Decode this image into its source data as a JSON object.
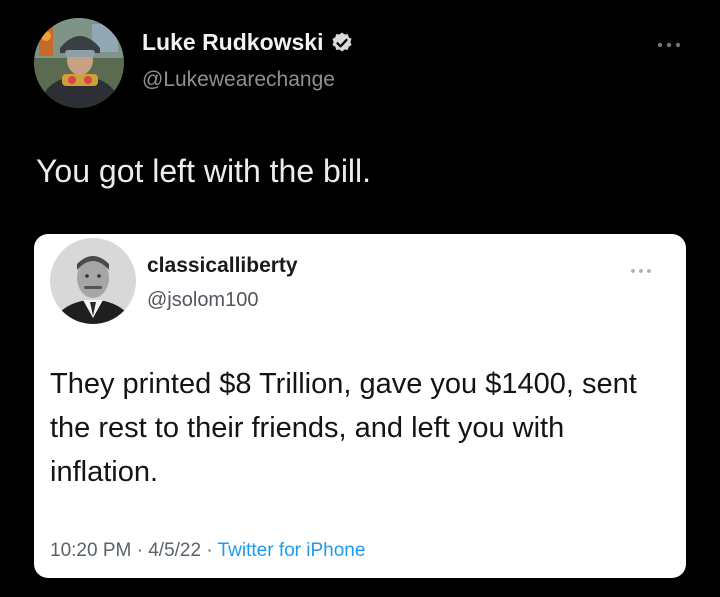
{
  "outer_tweet": {
    "author_name": "Luke Rudkowski",
    "handle": "@Lukewearechange",
    "verified": true,
    "text": "You got left with the bill.",
    "icons": {
      "avatar": "avatar-icon",
      "verified": "verified-badge-icon",
      "more": "more-options-icon"
    }
  },
  "quoted_tweet": {
    "author_name": "classicalliberty",
    "handle": "@jsolom100",
    "text": "They printed $8 Trillion, gave you $1400, sent the rest to their friends, and left you with inflation.",
    "time": "10:20 PM",
    "separator": "·",
    "date": "4/5/22",
    "source": "Twitter for iPhone",
    "icons": {
      "avatar": "avatar-icon",
      "more": "more-options-icon"
    }
  },
  "colors": {
    "background": "#000000",
    "card": "#ffffff",
    "accent": "#1d9bf0",
    "verified": "#d9d9d9"
  }
}
